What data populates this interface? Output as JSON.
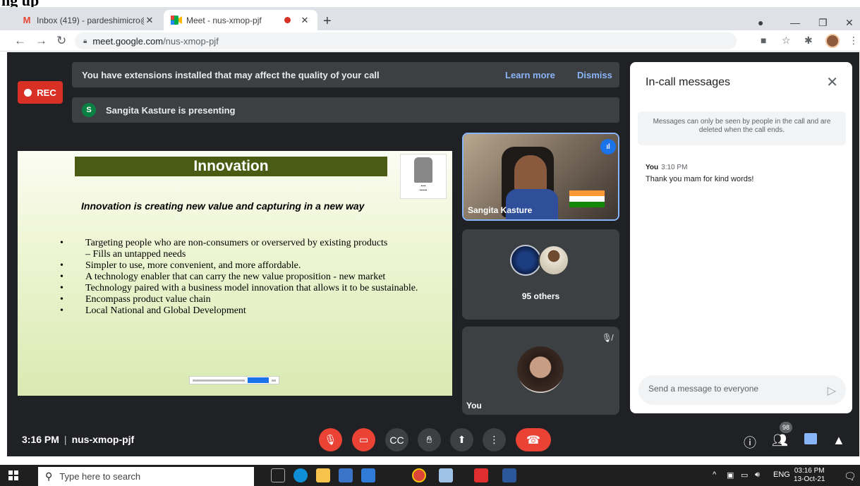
{
  "header_label": "ng up",
  "browser": {
    "tabs": [
      {
        "favicon": "gmail-icon",
        "title": "Inbox (419) - pardeshimicro@mc"
      },
      {
        "favicon": "meet-icon",
        "title": "Meet - nus-xmop-pjf"
      }
    ],
    "url_domain": "meet.google.com",
    "url_path": "/nus-xmop-pjf"
  },
  "meet": {
    "rec_label": "REC",
    "extension_banner": "You have extensions installed that may affect the quality of your call",
    "learn_more": "Learn more",
    "dismiss": "Dismiss",
    "presenter_initial": "S",
    "presenting_text": "Sangita Kasture is presenting",
    "slide": {
      "title": "Innovation",
      "subtitle": "Innovation is creating new value and capturing in a new way",
      "bullets": [
        "Targeting people who are non-consumers or overserved by existing products",
        "– Fills an untapped needs",
        "Simpler to use, more convenient, and more affordable.",
        "A technology enabler that can carry the new value proposition  - new market",
        "Technology paired with a business model innovation that allows it to be sustainable.",
        "Encompass product value chain",
        "Local National and Global Development"
      ]
    },
    "tiles": {
      "speaker_name": "Sangita Kasture",
      "others_label": "95 others",
      "self_label": "You"
    },
    "chat": {
      "title": "In-call messages",
      "note": "Messages can only be seen by people in the call and are deleted when the call ends.",
      "messages": [
        {
          "sender": "You",
          "time": "3:10 PM",
          "text": "Thank you mam for kind words!"
        }
      ],
      "input_placeholder": "Send a message to everyone"
    },
    "bottom": {
      "time": "3:16 PM",
      "meeting_code": "nus-xmop-pjf",
      "participants_count": "98"
    }
  },
  "taskbar": {
    "search_placeholder": "Type here to search",
    "language": "ENG",
    "time": "03:16 PM",
    "date": "13-Oct-21"
  }
}
